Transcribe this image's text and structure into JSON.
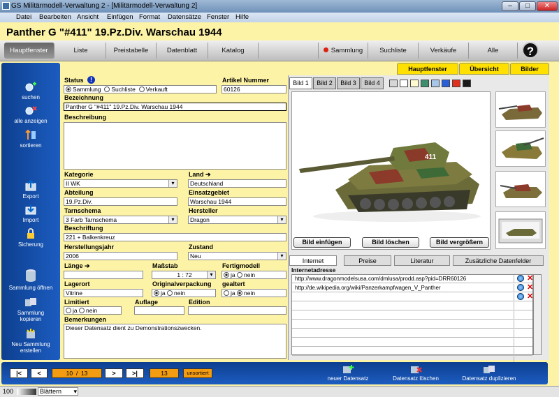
{
  "window": {
    "title": "GS Militärmodell-Verwaltung 2 - [Militärmodell-Verwaltung 2]"
  },
  "menu": [
    "Datei",
    "Bearbeiten",
    "Ansicht",
    "Einfügen",
    "Format",
    "Datensätze",
    "Fenster",
    "Hilfe"
  ],
  "record_title": "Panther G \"#411\" 19.Pz.Div. Warschau 1944",
  "nav": {
    "hauptfenster": "Hauptfenster",
    "liste": "Liste",
    "preistabelle": "Preistabelle",
    "datenblatt": "Datenblatt",
    "katalog": "Katalog",
    "sammlung": "Sammlung",
    "suchliste": "Suchliste",
    "verkaeufe": "Verkäufe",
    "alle": "Alle",
    "help": "?"
  },
  "sidebar": {
    "suchen": "suchen",
    "alle_anzeigen": "alle anzeigen",
    "sortieren": "sortieren",
    "export": "Export",
    "import": "Import",
    "sicherung": "Sicherung",
    "sammlung_oeffnen": "Sammlung öffnen",
    "sammlung_kopieren_1": "Sammlung",
    "sammlung_kopieren_2": "kopieren",
    "neu_1": "Neu Sammlung",
    "neu_2": "erstellen"
  },
  "view_tabs": {
    "hauptfenster": "Hauptfenster",
    "uebersicht": "Übersicht",
    "bilder": "Bilder"
  },
  "form": {
    "status_label": "Status",
    "status_options": [
      "Sammlung",
      "Suchliste",
      "Verkauft"
    ],
    "status_selected": "Sammlung",
    "artikel_label": "Artikel Nummer",
    "artikel": "60126",
    "bezeichnung_label": "Bezeichnung",
    "bezeichnung": "Panther G \"#411\" 19.Pz.Div. Warschau 1944",
    "beschreibung_label": "Beschreibung",
    "beschreibung": "",
    "kategorie_label": "Kategorie",
    "kategorie": "II WK",
    "land_label": "Land",
    "land": "Deutschland",
    "abteilung_label": "Abteilung",
    "abteilung": "19.Pz.Div.",
    "einsatzgebiet_label": "Einsatzgebiet",
    "einsatzgebiet": "Warschau 1944",
    "tarnschema_label": "Tarnschema",
    "tarnschema": "3 Farb Tarnschema",
    "hersteller_label": "Hersteller",
    "hersteller": "Dragon",
    "beschriftung_label": "Beschriftung",
    "beschriftung": "221 + Balkenkreuz",
    "herstellungsjahr_label": "Herstellungsjahr",
    "herstellungsjahr": "2006",
    "zustand_label": "Zustand",
    "zustand": "Neu",
    "laenge_label": "Länge",
    "laenge": "",
    "massstab_label": "Maßstab",
    "massstab": "1 : 72",
    "fertigmodell_label": "Fertigmodell",
    "fertigmodell_options": [
      "ja",
      "nein"
    ],
    "fertigmodell": "ja",
    "lagerort_label": "Lagerort",
    "lagerort": "Vitrine",
    "originalverpackung_label": "Originalverpackung",
    "originalverpackung_options": [
      "ja",
      "nein"
    ],
    "originalverpackung": "ja",
    "gealtert_label": "gealtert",
    "gealtert_options": [
      "ja",
      "nein"
    ],
    "gealtert": "nein",
    "limitiert_label": "Limitiert",
    "limitiert_options": [
      "ja",
      "nein"
    ],
    "limitiert": "",
    "auflage_label": "Auflage",
    "auflage": "",
    "edition_label": "Edition",
    "edition": "",
    "bemerkungen_label": "Bemerkungen",
    "bemerkungen": "Dieser Datensatz dient zu Demonstrationszwecken."
  },
  "image_tabs": [
    "Bild 1",
    "Bild 2",
    "Bild 3",
    "Bild 4"
  ],
  "swatches": [
    "#d6d6d6",
    "#ffffff",
    "#fff9d0",
    "#3f8f6f",
    "#a7c6e8",
    "#2a5fd8",
    "#e0301e",
    "#1a1a1a"
  ],
  "image_buttons": {
    "einfuegen": "Bild einfügen",
    "loeschen": "Bild löschen",
    "vergroessern": "Bild vergrößern"
  },
  "info_tabs": [
    "Internet",
    "Preise",
    "Literatur",
    "Zusätzliche Datenfelder"
  ],
  "internet": {
    "header": "Internetadresse",
    "urls": [
      "http://www.dragonmodelsusa.com/dmlusa/prodd.asp?pid=DRR60126",
      "http://de.wikipedia.org/wiki/Panzerkampfwagen_V_Panther",
      "",
      "",
      "",
      "",
      "",
      "",
      "",
      ""
    ]
  },
  "bottom": {
    "first": "|<",
    "prev": "<",
    "current": "10",
    "sep": "/",
    "total": "13",
    "next": ">",
    "last": ">|",
    "count": "13",
    "sort": "unsortiert",
    "neuer": "neuer Datensatz",
    "loeschen": "Datensatz löschen",
    "duplizieren": "Datensatz duplizieren"
  },
  "status": {
    "zoom": "100",
    "view": "Blättern"
  }
}
